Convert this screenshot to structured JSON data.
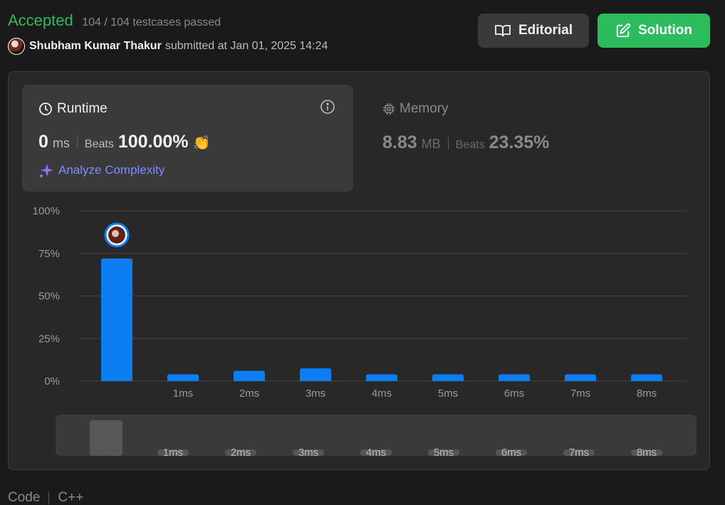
{
  "header": {
    "status": "Accepted",
    "testcases": "104 / 104 testcases passed",
    "username": "Shubham Kumar Thakur",
    "submitted_text": "submitted at Jan 01, 2025 14:24"
  },
  "buttons": {
    "editorial": "Editorial",
    "solution": "Solution"
  },
  "runtime": {
    "title": "Runtime",
    "value": "0",
    "unit": "ms",
    "beats_label": "Beats",
    "beats_pct": "100.00%",
    "analyze": "Analyze Complexity"
  },
  "memory": {
    "title": "Memory",
    "value": "8.83",
    "unit": "MB",
    "beats_label": "Beats",
    "beats_pct": "23.35%"
  },
  "chart_data": {
    "type": "bar",
    "categories": [
      "",
      "1ms",
      "2ms",
      "3ms",
      "4ms",
      "5ms",
      "6ms",
      "7ms",
      "8ms"
    ],
    "values": [
      72,
      4,
      6,
      7.5,
      4,
      4,
      4,
      4,
      4
    ],
    "yticks": [
      "100%",
      "75%",
      "50%",
      "25%",
      "0%"
    ],
    "ylim": [
      0,
      100
    ],
    "highlight_index": 0,
    "bar_color": "#0a7ef2",
    "grid": true
  },
  "navigator": {
    "labels": [
      "1ms",
      "2ms",
      "3ms",
      "4ms",
      "5ms",
      "6ms",
      "7ms",
      "8ms"
    ]
  },
  "footer": {
    "code": "Code",
    "language": "C++"
  },
  "colors": {
    "accent_green": "#2cbb5d",
    "accent_blue": "#0a7ef2",
    "analyze_purple": "#7c8dff"
  }
}
